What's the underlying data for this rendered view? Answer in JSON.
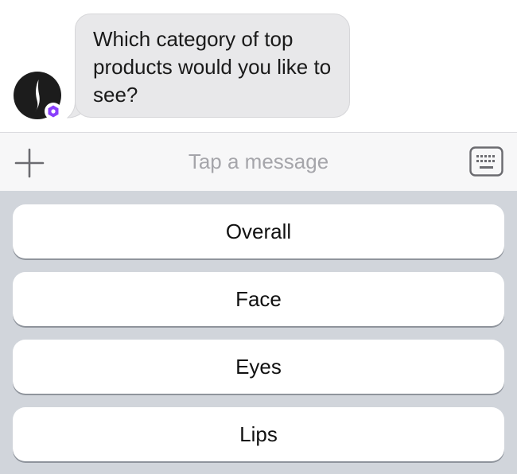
{
  "chat": {
    "bot_message": "Which category of top products would you like to see?",
    "avatar_icon": "brand-logo-icon",
    "badge_icon": "verified-bot-badge-icon"
  },
  "composer": {
    "add_icon": "plus-icon",
    "input_placeholder": "Tap a message",
    "input_value": "",
    "keyboard_icon": "keyboard-icon"
  },
  "quick_replies": [
    {
      "label": "Overall"
    },
    {
      "label": "Face"
    },
    {
      "label": "Eyes"
    },
    {
      "label": "Lips"
    }
  ],
  "colors": {
    "bubble_bg": "#e8e8ea",
    "composer_bg": "#f7f7f8",
    "replies_bg": "#d1d5db",
    "badge_accent": "#8a3ffc",
    "avatar_bg": "#1c1c1c"
  }
}
